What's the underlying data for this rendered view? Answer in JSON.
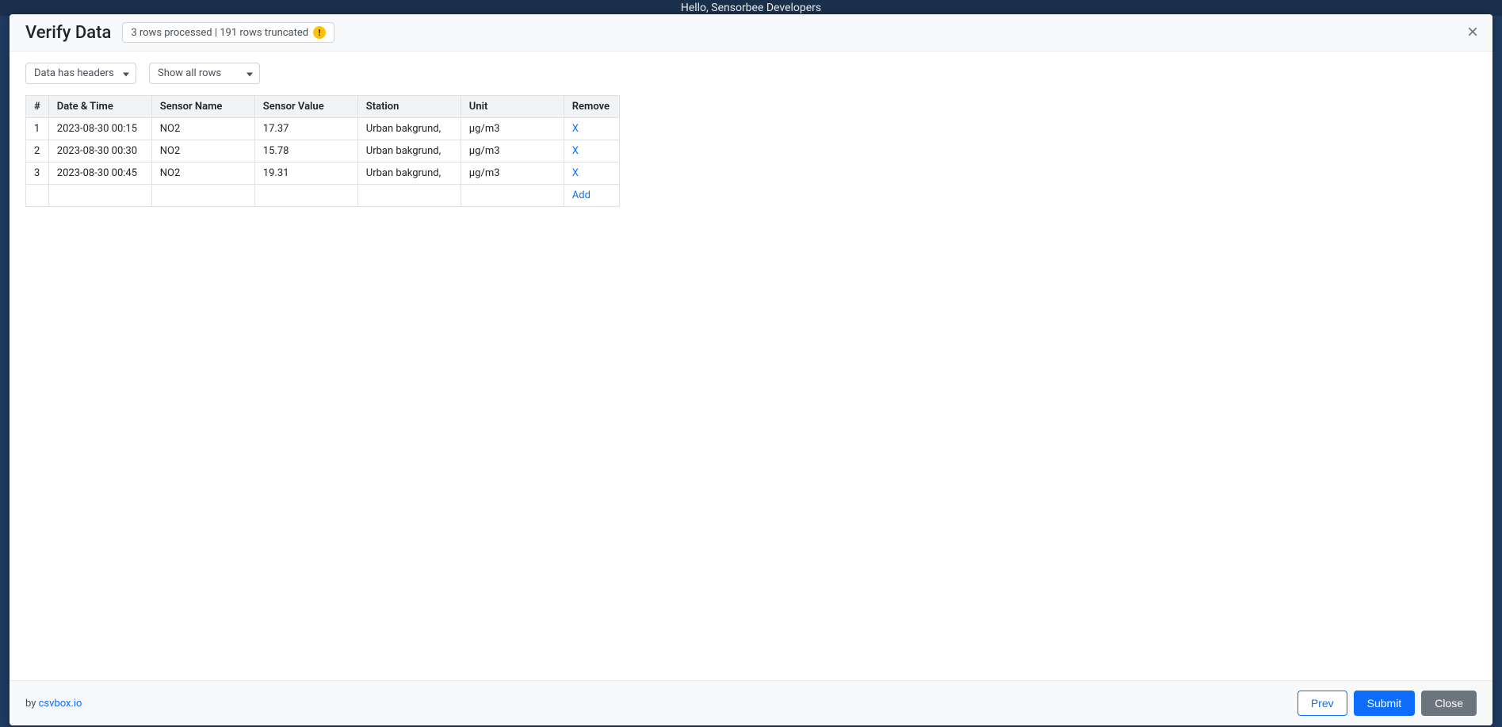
{
  "backdrop": {
    "hello_text": "Hello, Sensorbee Developers"
  },
  "modal": {
    "title": "Verify Data",
    "status_text": "3 rows processed | 191 rows truncated",
    "close_label": "×",
    "select_headers": "Data has headers",
    "select_filter": "Show all rows",
    "table": {
      "columns": {
        "index": "#",
        "datetime": "Date & Time",
        "sensor_name": "Sensor Name",
        "sensor_value": "Sensor Value",
        "station": "Station",
        "unit": "Unit",
        "remove": "Remove"
      },
      "rows": [
        {
          "idx": "1",
          "datetime": "2023-08-30 00:15",
          "sensor_name": "NO2",
          "sensor_value": "17.37",
          "station": "Urban bakgrund, ",
          "unit": "µg/m3",
          "remove": "X"
        },
        {
          "idx": "2",
          "datetime": "2023-08-30 00:30",
          "sensor_name": "NO2",
          "sensor_value": "15.78",
          "station": "Urban bakgrund, ",
          "unit": "µg/m3",
          "remove": "X"
        },
        {
          "idx": "3",
          "datetime": "2023-08-30 00:45",
          "sensor_name": "NO2",
          "sensor_value": "19.31",
          "station": "Urban bakgrund, ",
          "unit": "µg/m3",
          "remove": "X"
        }
      ],
      "add_label": "Add"
    },
    "footer": {
      "by_text": "by ",
      "by_link": "csvbox.io",
      "prev": "Prev",
      "submit": "Submit",
      "close": "Close"
    }
  }
}
